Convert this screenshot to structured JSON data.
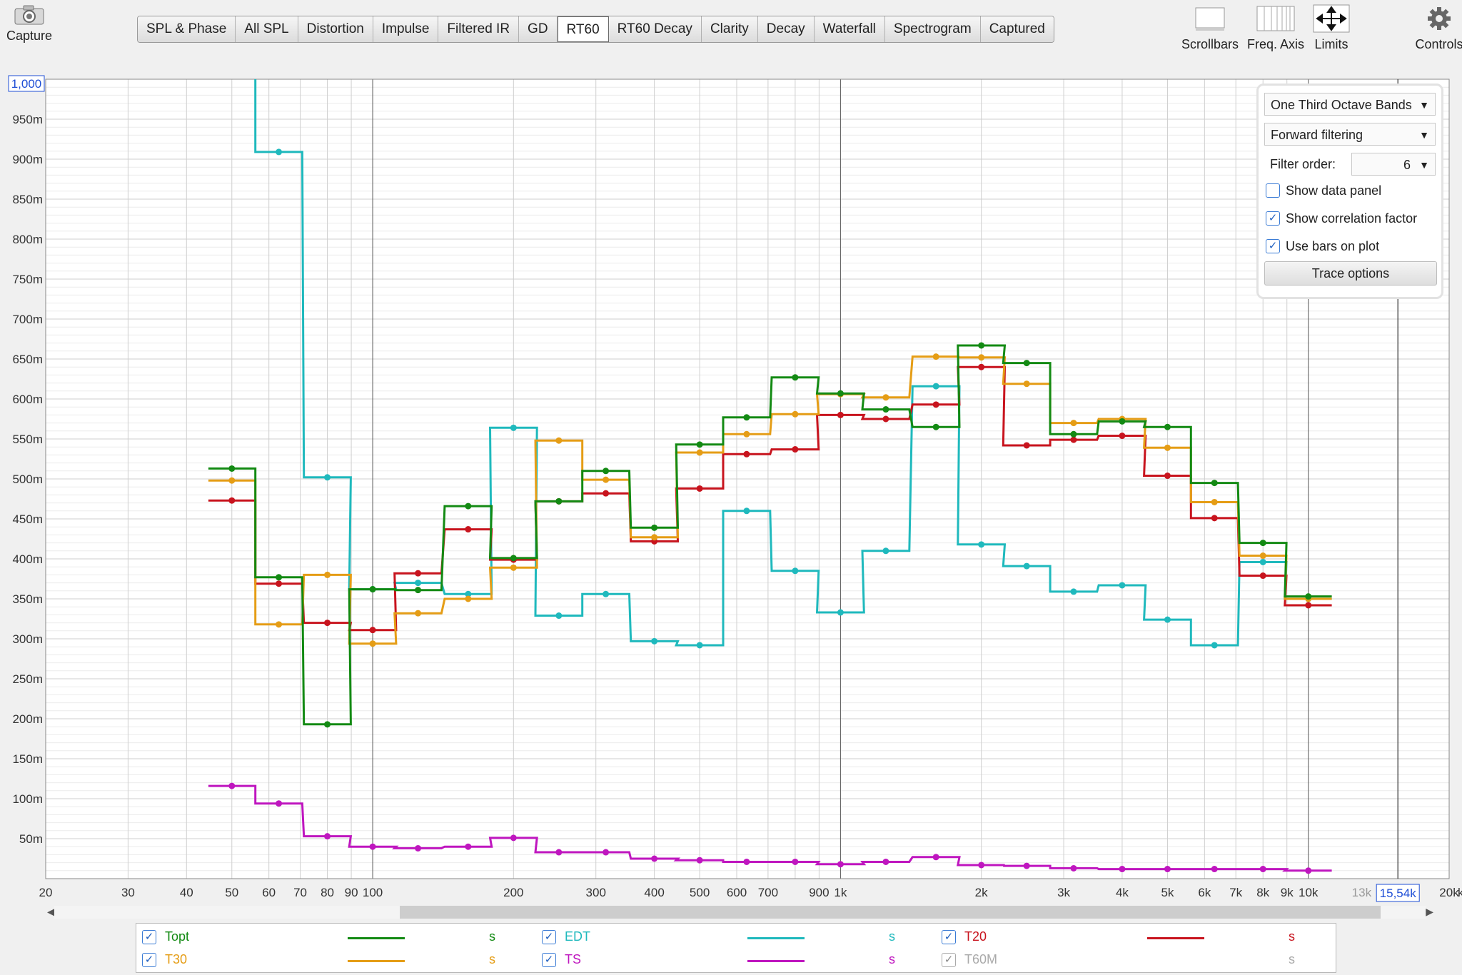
{
  "toolbar": {
    "capture_label": "Capture",
    "tabs": [
      "SPL & Phase",
      "All SPL",
      "Distortion",
      "Impulse",
      "Filtered IR",
      "GD",
      "RT60",
      "RT60 Decay",
      "Clarity",
      "Decay",
      "Waterfall",
      "Spectrogram",
      "Captured"
    ],
    "active_tab": "RT60",
    "scrollbars_label": "Scrollbars",
    "freq_axis_label": "Freq. Axis",
    "limits_label": "Limits",
    "controls_label": "Controls"
  },
  "controls": {
    "bands": "One Third Octave Bands",
    "filtering": "Forward filtering",
    "filter_order_label": "Filter order:",
    "filter_order": "6",
    "show_data_panel": "Show data panel",
    "show_data_panel_checked": false,
    "show_correlation": "Show correlation factor",
    "show_correlation_checked": true,
    "use_bars": "Use bars on plot",
    "use_bars_checked": true,
    "trace_options": "Trace options"
  },
  "chart_data": {
    "type": "line",
    "x_scale": "log",
    "xlim": [
      20,
      20000
    ],
    "ylim": [
      0,
      1.0
    ],
    "ylabel_unit": "s",
    "top_value_box": "1,000",
    "cursor_box": "15,54k",
    "unit_label": "kHz",
    "grid": true,
    "y_tick_labels": [
      "50m",
      "100m",
      "150m",
      "200m",
      "250m",
      "300m",
      "350m",
      "400m",
      "450m",
      "500m",
      "550m",
      "600m",
      "650m",
      "700m",
      "750m",
      "800m",
      "850m",
      "900m",
      "950m"
    ],
    "x_tick_labels": [
      {
        "f": 20,
        "label": "20"
      },
      {
        "f": 30,
        "label": "30"
      },
      {
        "f": 40,
        "label": "40"
      },
      {
        "f": 50,
        "label": "50"
      },
      {
        "f": 60,
        "label": "60"
      },
      {
        "f": 70,
        "label": "70"
      },
      {
        "f": 80,
        "label": "80"
      },
      {
        "f": 90,
        "label": "90"
      },
      {
        "f": 100,
        "label": "100"
      },
      {
        "f": 200,
        "label": "200"
      },
      {
        "f": 300,
        "label": "300"
      },
      {
        "f": 400,
        "label": "400"
      },
      {
        "f": 500,
        "label": "500"
      },
      {
        "f": 600,
        "label": "600"
      },
      {
        "f": 700,
        "label": "700"
      },
      {
        "f": 900,
        "label": "900"
      },
      {
        "f": 1000,
        "label": "1k"
      },
      {
        "f": 2000,
        "label": "2k"
      },
      {
        "f": 3000,
        "label": "3k"
      },
      {
        "f": 4000,
        "label": "4k"
      },
      {
        "f": 5000,
        "label": "5k"
      },
      {
        "f": 6000,
        "label": "6k"
      },
      {
        "f": 7000,
        "label": "7k"
      },
      {
        "f": 8000,
        "label": "8k"
      },
      {
        "f": 9000,
        "label": "9k"
      },
      {
        "f": 10000,
        "label": "10k"
      },
      {
        "f": 13000,
        "label": "13k"
      },
      {
        "f": 20000,
        "label": "20k"
      }
    ],
    "bands": [
      50,
      63,
      80,
      100,
      125,
      160,
      200,
      250,
      315,
      400,
      500,
      630,
      800,
      1000,
      1250,
      1600,
      2000,
      2500,
      3150,
      4000,
      5000,
      6300,
      8000,
      10000
    ],
    "series": [
      {
        "name": "Topt",
        "color": "#138a13",
        "values": [
          0.513,
          0.377,
          0.193,
          0.362,
          0.361,
          0.466,
          0.401,
          0.472,
          0.51,
          0.439,
          0.543,
          0.577,
          0.627,
          0.607,
          0.587,
          0.565,
          0.667,
          0.645,
          0.556,
          0.572,
          0.565,
          0.495,
          0.42,
          0.353
        ]
      },
      {
        "name": "EDT",
        "color": "#1fb9bd",
        "values": [
          1.15,
          0.909,
          0.502,
          0.362,
          0.37,
          0.356,
          0.564,
          0.329,
          0.356,
          0.297,
          0.292,
          0.46,
          0.385,
          0.333,
          0.41,
          0.616,
          0.418,
          0.391,
          0.359,
          0.367,
          0.324,
          0.292,
          0.396,
          0.35
        ]
      },
      {
        "name": "T20",
        "color": "#c8141e",
        "values": [
          0.473,
          0.369,
          0.32,
          0.311,
          0.382,
          0.437,
          0.399,
          0.472,
          0.482,
          0.422,
          0.488,
          0.531,
          0.537,
          0.58,
          0.575,
          0.593,
          0.64,
          0.542,
          0.549,
          0.554,
          0.504,
          0.451,
          0.379,
          0.342
        ]
      },
      {
        "name": "T30",
        "color": "#e59d16",
        "values": [
          0.498,
          0.318,
          0.38,
          0.294,
          0.332,
          0.35,
          0.389,
          0.548,
          0.499,
          0.427,
          0.533,
          0.556,
          0.581,
          0.606,
          0.602,
          0.653,
          0.652,
          0.619,
          0.57,
          0.575,
          0.539,
          0.471,
          0.404,
          0.35
        ]
      },
      {
        "name": "TS",
        "color": "#bf16bf",
        "values": [
          0.116,
          0.094,
          0.053,
          0.04,
          0.038,
          0.04,
          0.051,
          0.033,
          0.033,
          0.025,
          0.023,
          0.021,
          0.021,
          0.018,
          0.021,
          0.027,
          0.017,
          0.016,
          0.013,
          0.012,
          0.012,
          0.012,
          0.012,
          0.01
        ]
      }
    ]
  },
  "legend": {
    "items": [
      {
        "name": "Topt",
        "unit": "s",
        "color": "#138a13",
        "checked": true
      },
      {
        "name": "EDT",
        "unit": "s",
        "color": "#1fb9bd",
        "checked": true
      },
      {
        "name": "T20",
        "unit": "s",
        "color": "#c8141e",
        "checked": true
      },
      {
        "name": "T30",
        "unit": "s",
        "color": "#e59d16",
        "checked": true
      },
      {
        "name": "TS",
        "unit": "s",
        "color": "#bf16bf",
        "checked": true
      },
      {
        "name": "T60M",
        "unit": "s",
        "color": "#aaaaaa",
        "checked": true
      }
    ]
  }
}
